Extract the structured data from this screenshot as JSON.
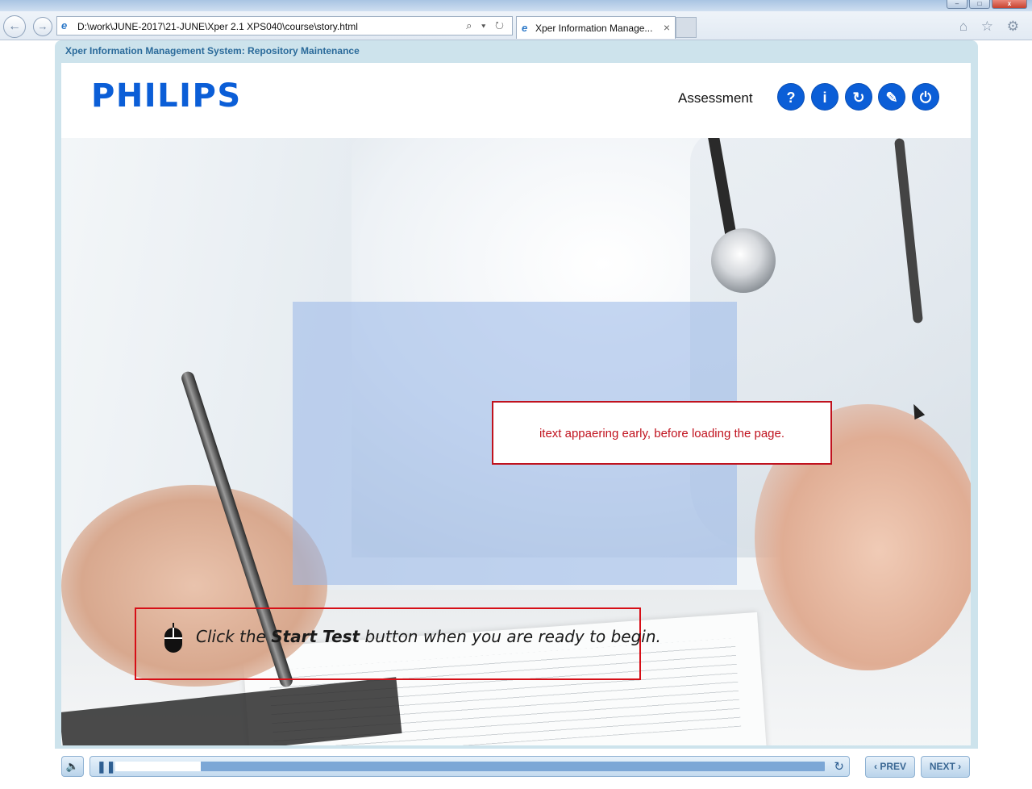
{
  "browser": {
    "url": "D:\\work\\JUNE-2017\\21-JUNE\\Xper 2.1 XPS040\\course\\story.html",
    "tab_title": "Xper Information Manage...",
    "back_icon": "back-arrow-icon",
    "forward_icon": "forward-arrow-icon",
    "glyphs": {
      "minimize": "–",
      "maximize": "□",
      "close": "x",
      "back": "←",
      "forward": "→",
      "ie": "e",
      "tab_close": "×",
      "address_tools": "⌕ ▾ ↻",
      "right_tools": "⌂ ☆ ⚙"
    }
  },
  "course": {
    "title": "Xper Information Management System: Repository Maintenance"
  },
  "header": {
    "logo": "PHILIPS",
    "section": "Assessment",
    "buttons": [
      {
        "icon": "help-icon",
        "glyph": "?"
      },
      {
        "icon": "info-icon",
        "glyph": "i"
      },
      {
        "icon": "refresh-icon",
        "glyph": "↻"
      },
      {
        "icon": "compass-icon",
        "glyph": "✎"
      },
      {
        "icon": "power-icon",
        "glyph": "⏻"
      }
    ]
  },
  "slide": {
    "note": "itext appaering early, before loading the page.",
    "instruction_prefix": "Click the",
    "instruction_bold": "Start Test",
    "instruction_suffix": "button when you are ready to begin."
  },
  "player": {
    "progress": 0.12,
    "prev_label": "PREV",
    "next_label": "NEXT",
    "volume_glyph": "🔈",
    "pause_glyph": "❚❚",
    "replay_glyph": "↻",
    "prev_glyph": "‹",
    "next_glyph": "›"
  },
  "colors": {
    "brand_blue": "#0b5ed7",
    "annotation_red": "#c0121e",
    "course_title": "#2a6a9a"
  }
}
